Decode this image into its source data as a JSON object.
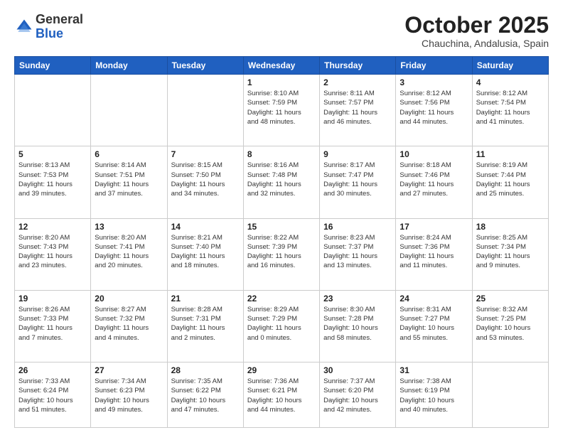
{
  "header": {
    "logo_general": "General",
    "logo_blue": "Blue",
    "month_title": "October 2025",
    "location": "Chauchina, Andalusia, Spain"
  },
  "days_of_week": [
    "Sunday",
    "Monday",
    "Tuesday",
    "Wednesday",
    "Thursday",
    "Friday",
    "Saturday"
  ],
  "weeks": [
    [
      {
        "day": "",
        "info": ""
      },
      {
        "day": "",
        "info": ""
      },
      {
        "day": "",
        "info": ""
      },
      {
        "day": "1",
        "info": "Sunrise: 8:10 AM\nSunset: 7:59 PM\nDaylight: 11 hours\nand 48 minutes."
      },
      {
        "day": "2",
        "info": "Sunrise: 8:11 AM\nSunset: 7:57 PM\nDaylight: 11 hours\nand 46 minutes."
      },
      {
        "day": "3",
        "info": "Sunrise: 8:12 AM\nSunset: 7:56 PM\nDaylight: 11 hours\nand 44 minutes."
      },
      {
        "day": "4",
        "info": "Sunrise: 8:12 AM\nSunset: 7:54 PM\nDaylight: 11 hours\nand 41 minutes."
      }
    ],
    [
      {
        "day": "5",
        "info": "Sunrise: 8:13 AM\nSunset: 7:53 PM\nDaylight: 11 hours\nand 39 minutes."
      },
      {
        "day": "6",
        "info": "Sunrise: 8:14 AM\nSunset: 7:51 PM\nDaylight: 11 hours\nand 37 minutes."
      },
      {
        "day": "7",
        "info": "Sunrise: 8:15 AM\nSunset: 7:50 PM\nDaylight: 11 hours\nand 34 minutes."
      },
      {
        "day": "8",
        "info": "Sunrise: 8:16 AM\nSunset: 7:48 PM\nDaylight: 11 hours\nand 32 minutes."
      },
      {
        "day": "9",
        "info": "Sunrise: 8:17 AM\nSunset: 7:47 PM\nDaylight: 11 hours\nand 30 minutes."
      },
      {
        "day": "10",
        "info": "Sunrise: 8:18 AM\nSunset: 7:46 PM\nDaylight: 11 hours\nand 27 minutes."
      },
      {
        "day": "11",
        "info": "Sunrise: 8:19 AM\nSunset: 7:44 PM\nDaylight: 11 hours\nand 25 minutes."
      }
    ],
    [
      {
        "day": "12",
        "info": "Sunrise: 8:20 AM\nSunset: 7:43 PM\nDaylight: 11 hours\nand 23 minutes."
      },
      {
        "day": "13",
        "info": "Sunrise: 8:20 AM\nSunset: 7:41 PM\nDaylight: 11 hours\nand 20 minutes."
      },
      {
        "day": "14",
        "info": "Sunrise: 8:21 AM\nSunset: 7:40 PM\nDaylight: 11 hours\nand 18 minutes."
      },
      {
        "day": "15",
        "info": "Sunrise: 8:22 AM\nSunset: 7:39 PM\nDaylight: 11 hours\nand 16 minutes."
      },
      {
        "day": "16",
        "info": "Sunrise: 8:23 AM\nSunset: 7:37 PM\nDaylight: 11 hours\nand 13 minutes."
      },
      {
        "day": "17",
        "info": "Sunrise: 8:24 AM\nSunset: 7:36 PM\nDaylight: 11 hours\nand 11 minutes."
      },
      {
        "day": "18",
        "info": "Sunrise: 8:25 AM\nSunset: 7:34 PM\nDaylight: 11 hours\nand 9 minutes."
      }
    ],
    [
      {
        "day": "19",
        "info": "Sunrise: 8:26 AM\nSunset: 7:33 PM\nDaylight: 11 hours\nand 7 minutes."
      },
      {
        "day": "20",
        "info": "Sunrise: 8:27 AM\nSunset: 7:32 PM\nDaylight: 11 hours\nand 4 minutes."
      },
      {
        "day": "21",
        "info": "Sunrise: 8:28 AM\nSunset: 7:31 PM\nDaylight: 11 hours\nand 2 minutes."
      },
      {
        "day": "22",
        "info": "Sunrise: 8:29 AM\nSunset: 7:29 PM\nDaylight: 11 hours\nand 0 minutes."
      },
      {
        "day": "23",
        "info": "Sunrise: 8:30 AM\nSunset: 7:28 PM\nDaylight: 10 hours\nand 58 minutes."
      },
      {
        "day": "24",
        "info": "Sunrise: 8:31 AM\nSunset: 7:27 PM\nDaylight: 10 hours\nand 55 minutes."
      },
      {
        "day": "25",
        "info": "Sunrise: 8:32 AM\nSunset: 7:25 PM\nDaylight: 10 hours\nand 53 minutes."
      }
    ],
    [
      {
        "day": "26",
        "info": "Sunrise: 7:33 AM\nSunset: 6:24 PM\nDaylight: 10 hours\nand 51 minutes."
      },
      {
        "day": "27",
        "info": "Sunrise: 7:34 AM\nSunset: 6:23 PM\nDaylight: 10 hours\nand 49 minutes."
      },
      {
        "day": "28",
        "info": "Sunrise: 7:35 AM\nSunset: 6:22 PM\nDaylight: 10 hours\nand 47 minutes."
      },
      {
        "day": "29",
        "info": "Sunrise: 7:36 AM\nSunset: 6:21 PM\nDaylight: 10 hours\nand 44 minutes."
      },
      {
        "day": "30",
        "info": "Sunrise: 7:37 AM\nSunset: 6:20 PM\nDaylight: 10 hours\nand 42 minutes."
      },
      {
        "day": "31",
        "info": "Sunrise: 7:38 AM\nSunset: 6:19 PM\nDaylight: 10 hours\nand 40 minutes."
      },
      {
        "day": "",
        "info": ""
      }
    ]
  ]
}
